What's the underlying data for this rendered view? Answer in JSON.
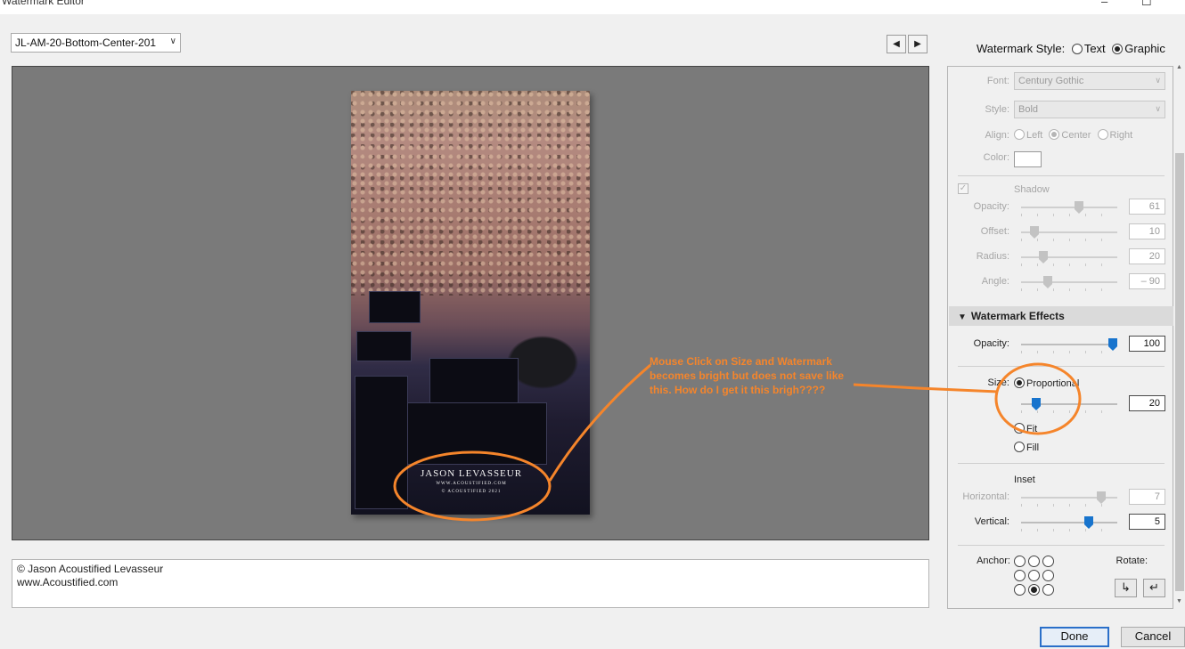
{
  "window": {
    "title": "Watermark Editor",
    "minimize_glyph": "–",
    "maximize_glyph": "☐"
  },
  "preset": {
    "value": "JL-AM-20-Bottom-Center-201",
    "chevron": "∨"
  },
  "nav": {
    "prev": "◀",
    "next": "▶"
  },
  "watermark_style": {
    "label": "Watermark Style:",
    "text_option": "Text",
    "graphic_option": "Graphic",
    "selected": "Graphic"
  },
  "preview": {
    "watermark_line1": "JASON LEVASSEUR",
    "watermark_line2": "WWW.ACOUSTIFIED.COM",
    "watermark_line3": "© ACOUSTIFIED 2021"
  },
  "caption": {
    "line1": "© Jason Acoustified Levasseur",
    "line2": "www.Acoustified.com"
  },
  "text_options": {
    "font_label": "Font:",
    "font_value": "Century Gothic",
    "style_label": "Style:",
    "style_value": "Bold",
    "align_label": "Align:",
    "align_left": "Left",
    "align_center": "Center",
    "align_right": "Right",
    "color_label": "Color:",
    "color_value": "#ffffff"
  },
  "shadow": {
    "label": "Shadow",
    "checked": true,
    "opacity_label": "Opacity:",
    "opacity_value": "61",
    "offset_label": "Offset:",
    "offset_value": "10",
    "radius_label": "Radius:",
    "radius_value": "20",
    "angle_label": "Angle:",
    "angle_value": "– 90"
  },
  "effects": {
    "header": "Watermark Effects",
    "collapse_glyph": "▼",
    "opacity_label": "Opacity:",
    "opacity_value": "100",
    "size_label": "Size:",
    "size_proportional": "Proportional",
    "size_value": "20",
    "size_fit": "Fit",
    "size_fill": "Fill",
    "size_selected": "Proportional",
    "inset_label": "Inset",
    "horizontal_label": "Horizontal:",
    "horizontal_value": "7",
    "vertical_label": "Vertical:",
    "vertical_value": "5",
    "anchor_label": "Anchor:",
    "anchor_selected": "bottom-center",
    "rotate_label": "Rotate:",
    "rotate_ccw_glyph": "↳",
    "rotate_cw_glyph": "↵"
  },
  "annotation": {
    "text": "Mouse Click on Size and Watermark becomes bright but does not save like this. How do I get it this brigh????",
    "color": "#f5852b"
  },
  "buttons": {
    "done": "Done",
    "cancel": "Cancel"
  },
  "colors": {
    "accent": "#1874cd",
    "preview_bg": "#7a7a7a"
  }
}
